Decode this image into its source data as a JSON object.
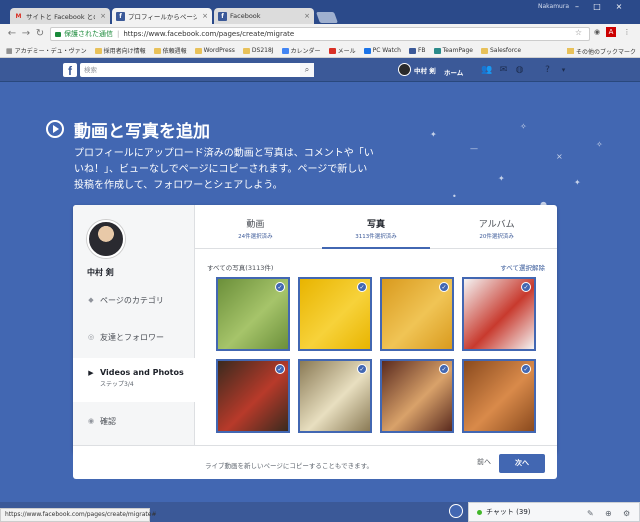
{
  "browser": {
    "tabs": [
      {
        "icon": "gmail-icon",
        "title": "サイトと Facebook との連携"
      },
      {
        "icon": "facebook-icon",
        "title": "プロフィールからページへの移"
      },
      {
        "icon": "facebook-icon",
        "title": "Facebook"
      }
    ],
    "window_user": "Nakamura",
    "secure_label": "保護された通信",
    "url": "https://www.facebook.com/pages/create/migrate",
    "bookmarks": [
      "アカデミー・デュ・ヴァン",
      "採用者向け情報",
      "依頼週報",
      "WordPress",
      "DS218J",
      "カレンダー",
      "メール",
      "PC Watch",
      "FB",
      "TeamPage",
      "Salesforce"
    ],
    "other_bookmarks": "その他のブックマーク",
    "status_url": "https://www.facebook.com/pages/create/migrate#"
  },
  "fb_header": {
    "search_placeholder": "検索",
    "user_name": "中村 剣",
    "home": "ホーム"
  },
  "hero": {
    "title": "動画と写真を追加",
    "description": "プロフィールにアップロード済みの動画と写真は、コメントや「いいね！」、ビューなしでページにコピーされます。ページで新しい投稿を作成して、フォロワーとシェアしよう。"
  },
  "sidebar": {
    "profile_name": "中村 剣",
    "items": [
      {
        "icon": "tag-icon",
        "label": "ページのカテゴリ"
      },
      {
        "icon": "people-icon",
        "label": "友達とフォロワー"
      },
      {
        "icon": "video-icon",
        "label": "Videos and Photos",
        "sub": "ステップ3/4"
      },
      {
        "icon": "eye-icon",
        "label": "確認"
      }
    ]
  },
  "content_tabs": [
    {
      "label": "動画",
      "sub": "24件選択済み"
    },
    {
      "label": "写真",
      "sub": "3113件選択済み"
    },
    {
      "label": "アルバム",
      "sub": "20件選択済み"
    }
  ],
  "photos": {
    "all_label": "すべての写真(3113件)",
    "deselect_all": "すべて選択解除",
    "items": [
      {
        "name": "green-onions",
        "colors": [
          "#6b8f3a",
          "#a6c46a"
        ]
      },
      {
        "name": "corn",
        "colors": [
          "#e8b400",
          "#f7d23a"
        ]
      },
      {
        "name": "grilled-corn",
        "colors": [
          "#d99a1e",
          "#f0c455"
        ]
      },
      {
        "name": "document",
        "colors": [
          "#f4f4f4",
          "#c83a2e"
        ]
      },
      {
        "name": "sake-bottles",
        "colors": [
          "#3a2a1e",
          "#b83a2a"
        ]
      },
      {
        "name": "wine-glass",
        "colors": [
          "#8a7a55",
          "#e8dfc0"
        ]
      },
      {
        "name": "shop-display",
        "colors": [
          "#5a2a1e",
          "#d9a26a"
        ]
      },
      {
        "name": "fried-chicken",
        "colors": [
          "#8a4a1e",
          "#d98a4a"
        ]
      }
    ]
  },
  "footer": {
    "note": "ライブ動画を新しいページにコピーすることもできます。",
    "back": "前へ",
    "next": "次へ"
  },
  "chat": {
    "label": "チャット (39)"
  },
  "colors": {
    "fb_blue": "#3b5998",
    "hero_blue": "#4267b2",
    "chrome_tab": "#dcdcdc"
  }
}
